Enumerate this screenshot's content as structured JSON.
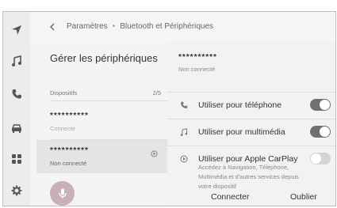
{
  "breadcrumb": {
    "parent": "Paramètres",
    "current": "Bluetooth et Périphériques"
  },
  "left_panel": {
    "title": "Gérer les périphériques",
    "section_label": "Dispositifs",
    "count": "2/5",
    "devices": [
      {
        "name": "**********",
        "status": "Connecté",
        "selected": false
      },
      {
        "name": "**********",
        "status": "Non connecté",
        "selected": true
      }
    ]
  },
  "detail": {
    "device_name": "**********",
    "device_status": "Non connecté",
    "options": [
      {
        "label": "Utiliser pour téléphone",
        "icon": "phone-icon",
        "enabled": true
      },
      {
        "label": "Utiliser pour multimédia",
        "icon": "music-note-icon",
        "enabled": true
      },
      {
        "label": "Utiliser pour Apple CarPlay",
        "icon": "carplay-icon",
        "enabled": false,
        "description": "Accédez à Navigation, Téléphone, Multimédia et d'autres services depuis votre dispositif"
      }
    ],
    "connect_label": "Connecter",
    "forget_label": "Oublier"
  },
  "rail": {
    "items": [
      "navigation-icon",
      "music-icon",
      "phone-icon",
      "car-icon",
      "apps-grid-icon",
      "settings-gear-icon"
    ]
  },
  "colors": {
    "toggle_on": "#707070",
    "toggle_off": "#d4d4d4",
    "mic_button": "#c9b0b6"
  }
}
